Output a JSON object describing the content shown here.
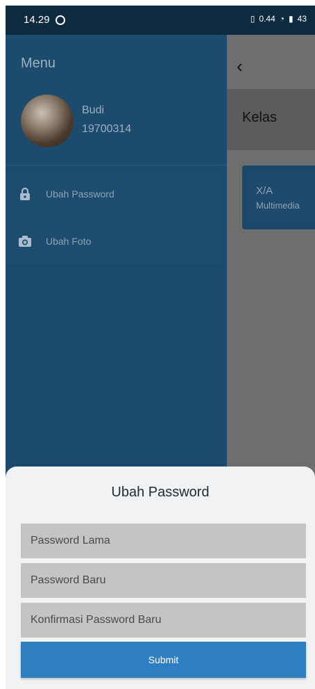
{
  "status_bar": {
    "time": "14.29",
    "net_speed": "0.44",
    "battery": "43"
  },
  "drawer": {
    "title": "Menu",
    "user": {
      "name": "Budi",
      "id": "19700314"
    },
    "items": [
      {
        "label": "Ubah Password",
        "icon": "lock-icon"
      },
      {
        "label": "Ubah Foto",
        "icon": "camera-icon"
      }
    ]
  },
  "background_page": {
    "back_icon": "back-arrow-icon",
    "title": "Kelas",
    "class_card": {
      "name": "X/A",
      "desc": "Multimedia"
    }
  },
  "sheet": {
    "title": "Ubah Password",
    "fields": [
      {
        "placeholder": "Password Lama"
      },
      {
        "placeholder": "Password Baru"
      },
      {
        "placeholder": "Konfirmasi Password Baru"
      }
    ],
    "submit_label": "Submit"
  },
  "colors": {
    "drawer": "#1c4a6c",
    "status_bar": "#0e2a3f",
    "submit": "#2e7fc2",
    "sheet": "#f1f2f3",
    "field": "#c4c4c4"
  }
}
